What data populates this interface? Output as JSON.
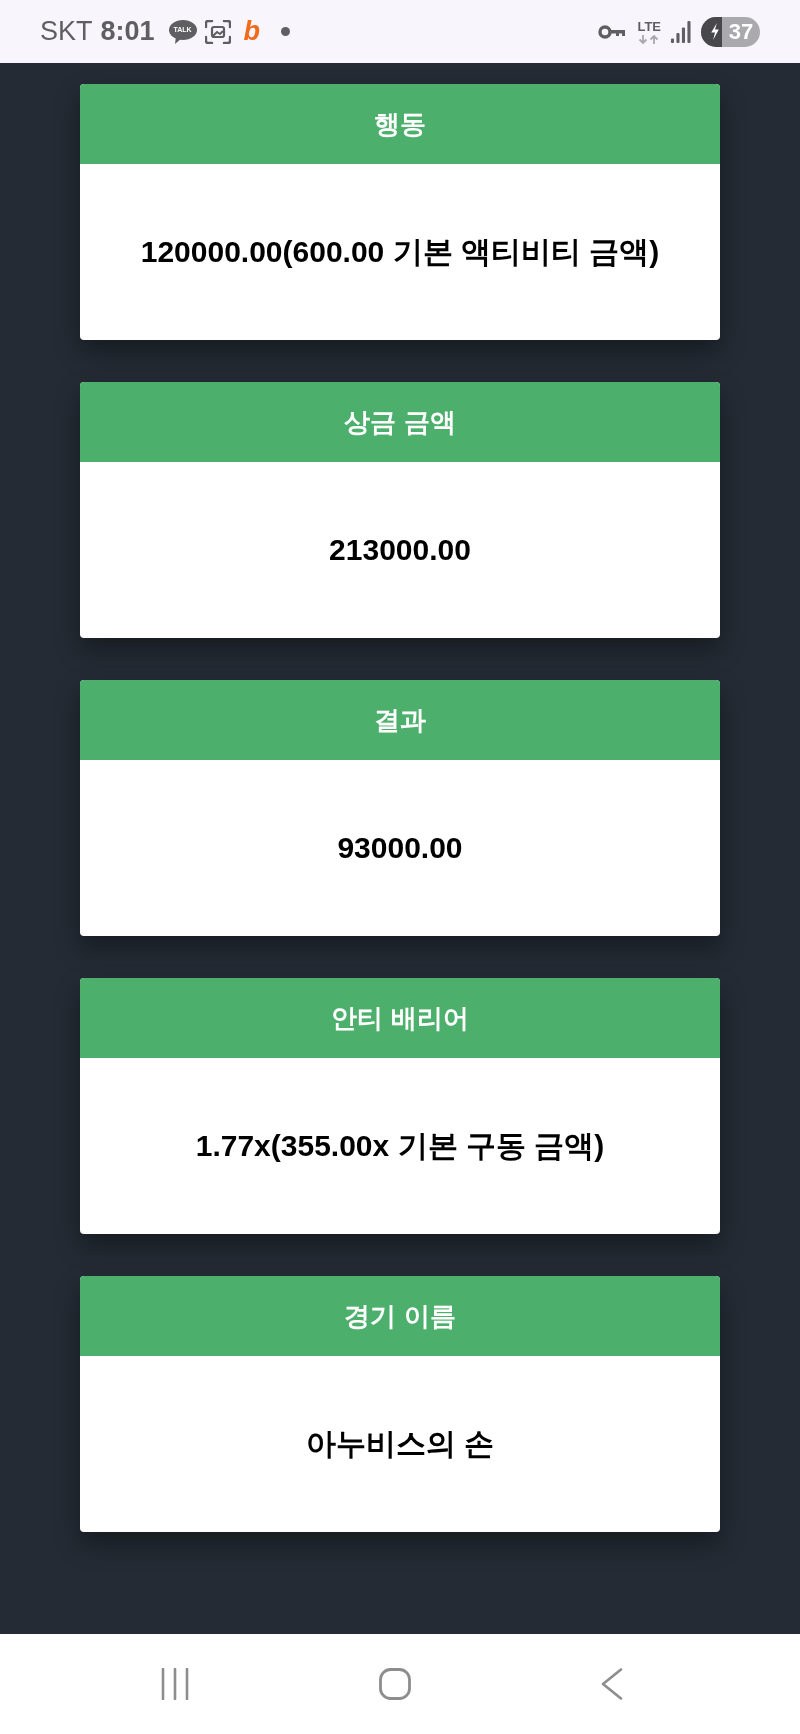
{
  "status_bar": {
    "carrier": "SKT",
    "time": "8:01",
    "chat_badge": "TALK",
    "app_logo": "b",
    "network_type": "LTE",
    "battery": "37",
    "charging": true
  },
  "cards": [
    {
      "title": "행동",
      "value": "120000.00(600.00 기본 액티비티 금액)"
    },
    {
      "title": "상금 금액",
      "value": "213000.00"
    },
    {
      "title": "결과",
      "value": "93000.00"
    },
    {
      "title": "안티 배리어",
      "value": "1.77x(355.00x 기본 구동 금액)"
    },
    {
      "title": "경기 이름",
      "value": "아누비스의 손"
    }
  ]
}
